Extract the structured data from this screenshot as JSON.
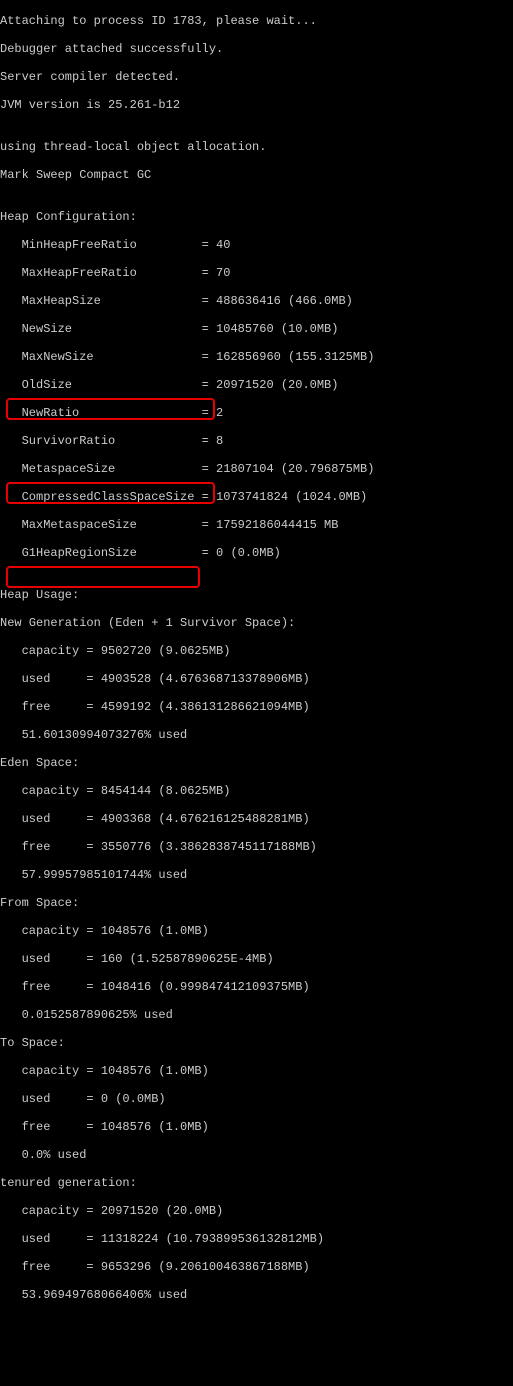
{
  "header": {
    "attach_line": "Attaching to process ID 1783, please wait...",
    "attached": "Debugger attached successfully.",
    "compiler": "Server compiler detected.",
    "jvm_version": "JVM version is 25.261-b12",
    "blank": "",
    "alloc": "using thread-local object allocation.",
    "gc": "Mark Sweep Compact GC"
  },
  "heap_config_title": "Heap Configuration:",
  "heap_config": [
    "   MinHeapFreeRatio         = 40",
    "   MaxHeapFreeRatio         = 70",
    "   MaxHeapSize              = 488636416 (466.0MB)",
    "   NewSize                  = 10485760 (10.0MB)",
    "   MaxNewSize               = 162856960 (155.3125MB)",
    "   OldSize                  = 20971520 (20.0MB)",
    "   NewRatio                 = 2",
    "   SurvivorRatio            = 8",
    "   MetaspaceSize            = 21807104 (20.796875MB)",
    "   CompressedClassSpaceSize = 1073741824 (1024.0MB)",
    "   MaxMetaspaceSize         = 17592186044415 MB",
    "   G1HeapRegionSize         = 0 (0.0MB)"
  ],
  "heap_usage_title": "Heap Usage:",
  "newgen": {
    "title": "New Generation (Eden + 1 Survivor Space):",
    "capacity": "   capacity = 9502720 (9.0625MB)",
    "used": "   used     = 4903528 (4.676368713378906MB)",
    "free": "   free     = 4599192 (4.386131286621094MB)",
    "pct": "   51.60130994073276% used"
  },
  "eden": {
    "title": "Eden Space:",
    "capacity": "   capacity = 8454144 (8.0625MB)",
    "used": "   used     = 4903368 (4.676216125488281MB)",
    "free": "   free     = 3550776 (3.3862838745117188MB)",
    "pct": "   57.99957985101744% used"
  },
  "from": {
    "title": "From Space:",
    "capacity": "   capacity = 1048576 (1.0MB)",
    "used": "   used     = 160 (1.52587890625E-4MB)",
    "free": "   free     = 1048416 (0.999847412109375MB)",
    "pct": "   0.0152587890625% used"
  },
  "to": {
    "title": "To Space:",
    "capacity": "   capacity = 1048576 (1.0MB)",
    "used": "   used     = 0 (0.0MB)",
    "free": "   free     = 1048576 (1.0MB)",
    "pct": "   0.0% used"
  },
  "tenured": {
    "title": "tenured generation:",
    "capacity": "   capacity = 20971520 (20.0MB)",
    "used": "   used     = 11318224 (10.793899536132812MB)",
    "free": "   free     = 9653296 (9.206100463867188MB)",
    "pct": "   53.96949768066406% used"
  },
  "chart_data": {
    "type": "table",
    "title": "JVM Heap Usage",
    "series": [
      {
        "name": "New Generation",
        "capacity_mb": 9.0625,
        "used_mb": 4.676368713378906,
        "free_mb": 4.386131286621094,
        "used_pct": 51.60130994073276
      },
      {
        "name": "Eden Space",
        "capacity_mb": 8.0625,
        "used_mb": 4.676216125488281,
        "free_mb": 3.3862838745117188,
        "used_pct": 57.99957985101744
      },
      {
        "name": "From Space",
        "capacity_mb": 1.0,
        "used_mb": 0.000152587890625,
        "free_mb": 0.999847412109375,
        "used_pct": 0.0152587890625
      },
      {
        "name": "To Space",
        "capacity_mb": 1.0,
        "used_mb": 0.0,
        "free_mb": 1.0,
        "used_pct": 0.0
      },
      {
        "name": "Tenured Generation",
        "capacity_mb": 20.0,
        "used_mb": 10.793899536132812,
        "free_mb": 9.206100463867188,
        "used_pct": 53.96949768066406
      }
    ],
    "heap_config": {
      "MinHeapFreeRatio": 40,
      "MaxHeapFreeRatio": 70,
      "MaxHeapSize_mb": 466.0,
      "NewSize_mb": 10.0,
      "MaxNewSize_mb": 155.3125,
      "OldSize_mb": 20.0,
      "NewRatio": 2,
      "SurvivorRatio": 8,
      "MetaspaceSize_mb": 20.796875,
      "CompressedClassSpaceSize_mb": 1024.0,
      "MaxMetaspaceSize_mb": 17592186044415,
      "G1HeapRegionSize_mb": 0.0
    }
  }
}
